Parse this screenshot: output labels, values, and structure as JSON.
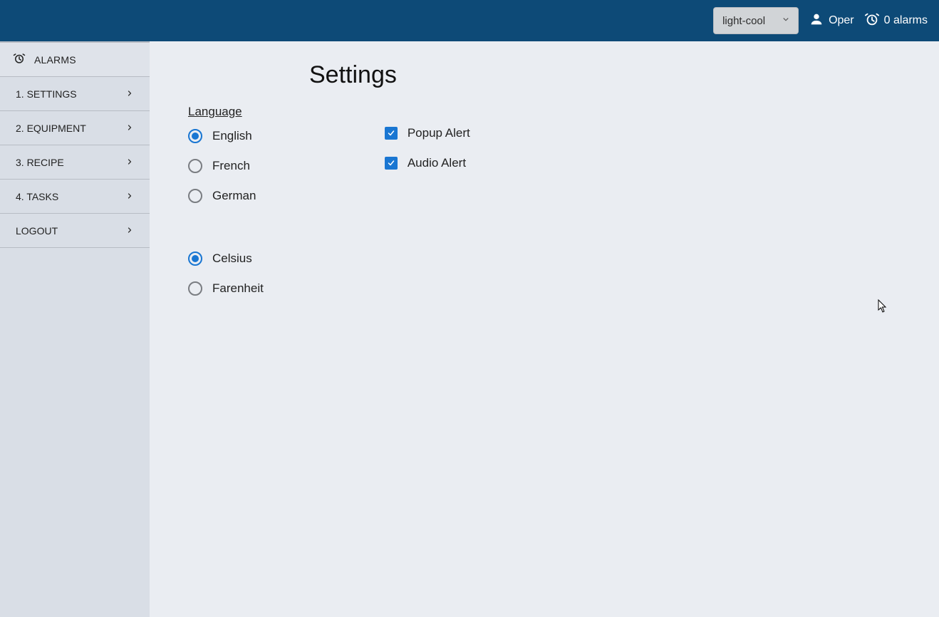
{
  "topbar": {
    "theme": "light-cool",
    "user_name": "Oper",
    "alarms_label": "0 alarms"
  },
  "sidebar": {
    "alarms_label": "ALARMS",
    "items": [
      {
        "label": "1. SETTINGS"
      },
      {
        "label": "2. EQUIPMENT"
      },
      {
        "label": "3. RECIPE"
      },
      {
        "label": "4. TASKS"
      },
      {
        "label": "LOGOUT"
      }
    ]
  },
  "page": {
    "title": "Settings",
    "language_heading": "Language",
    "languages": [
      {
        "label": "English",
        "selected": true
      },
      {
        "label": "French",
        "selected": false
      },
      {
        "label": "German",
        "selected": false
      }
    ],
    "temperature": [
      {
        "label": "Celsius",
        "selected": true
      },
      {
        "label": "Farenheit",
        "selected": false
      }
    ],
    "alerts": [
      {
        "label": "Popup Alert",
        "checked": true
      },
      {
        "label": "Audio Alert",
        "checked": true
      }
    ]
  }
}
